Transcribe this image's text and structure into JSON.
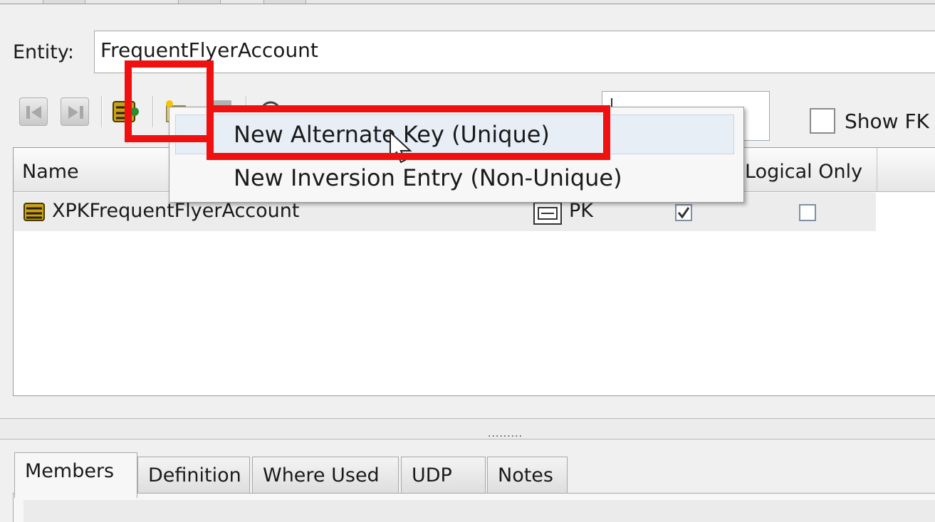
{
  "entity": {
    "label": "Entity:",
    "value": "FrequentFlyerAccount"
  },
  "toolbar": {
    "icons": [
      "nav-previous-icon",
      "nav-next-icon",
      "key-group-icon",
      "new-key-icon",
      "delete-key-icon",
      "properties-icon"
    ],
    "filter_value": "",
    "show_fk_label": "Show FK",
    "show_fk_checked": false
  },
  "table": {
    "columns": [
      "Name",
      "Logical Only"
    ],
    "rows": [
      {
        "name": "XPKFrequentFlyerAccount",
        "type": "PK",
        "generate_checked": true,
        "logical_only_checked": false
      }
    ]
  },
  "context_menu": {
    "items": [
      "New Alternate Key (Unique)",
      "New Inversion Entry (Non-Unique)"
    ],
    "hovered_index": 0
  },
  "splitter": {
    "grip": "........."
  },
  "bottom_tabs": {
    "tabs": [
      "Members",
      "Definition",
      "Where Used",
      "UDP",
      "Notes"
    ],
    "active_index": 0
  },
  "annotations": {
    "highlight_color": "#f01010"
  }
}
